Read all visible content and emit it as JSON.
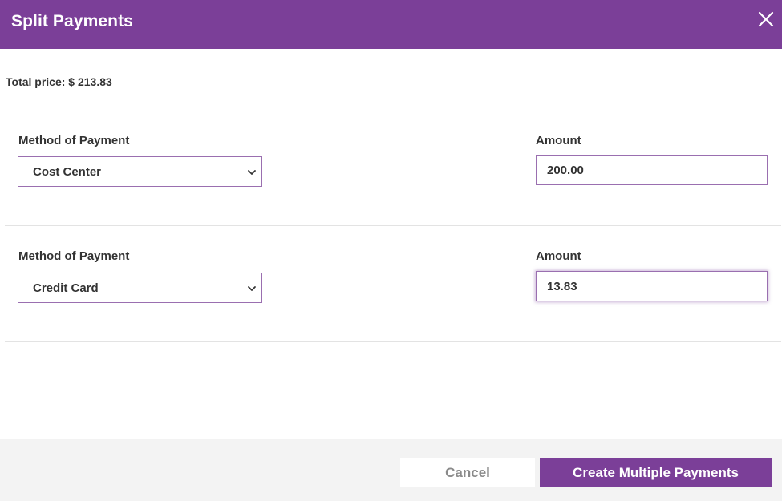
{
  "dialog": {
    "title": "Split Payments",
    "close_icon": "close-icon"
  },
  "total": {
    "text": "Total price: $ 213.83"
  },
  "payments": [
    {
      "method_label": "Method of Payment",
      "method_value": "Cost Center",
      "amount_label": "Amount",
      "amount_value": "200.00"
    },
    {
      "method_label": "Method of Payment",
      "method_value": "Credit Card",
      "amount_label": "Amount",
      "amount_value": "13.83"
    }
  ],
  "footer": {
    "cancel_label": "Cancel",
    "create_label": "Create Multiple Payments"
  },
  "colors": {
    "brand": "#7b3f98",
    "field_border": "#9a6fb0",
    "footer_bg": "#f3f3f3"
  }
}
